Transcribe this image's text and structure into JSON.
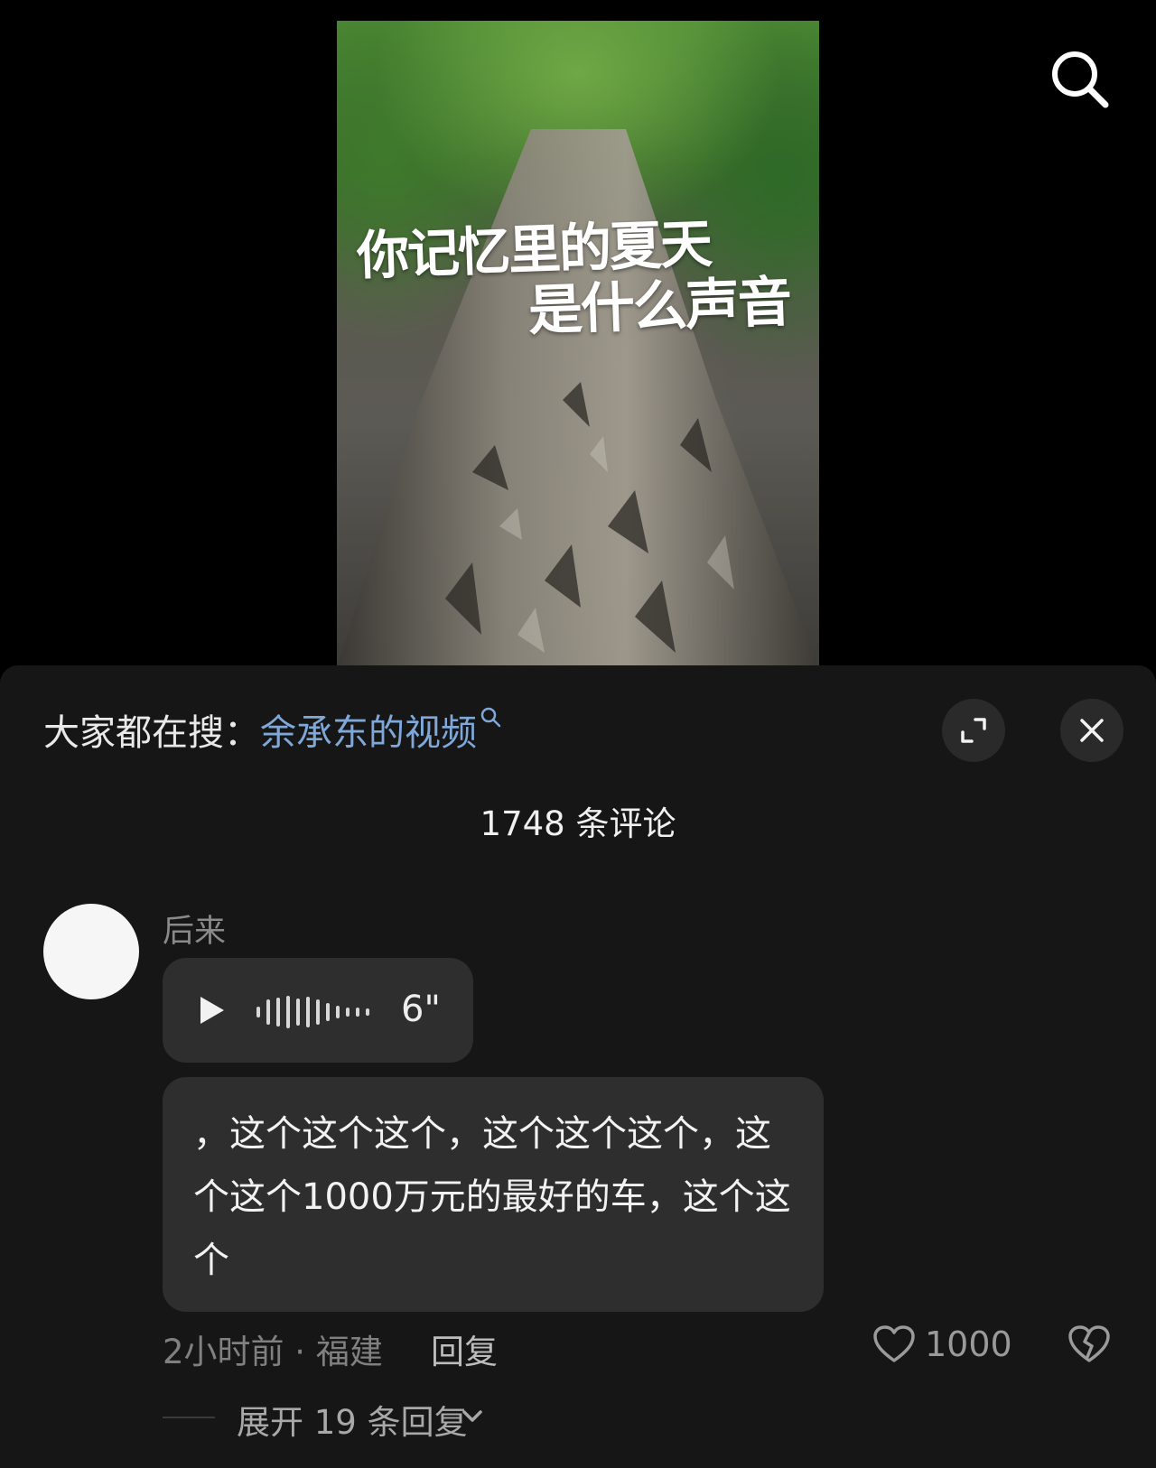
{
  "video": {
    "poster_title_line1": "你记忆里的夏天",
    "poster_title_line2": "是什么声音"
  },
  "top_bar": {
    "search_icon": "search-icon"
  },
  "sheet": {
    "trending_prefix": "大家都在搜：",
    "trending_query": "余承东的视频",
    "expand_icon": "expand-icon",
    "close_icon": "close-icon",
    "comment_count_label": "1748 条评论"
  },
  "comment": {
    "username": "后来",
    "voice_duration": "6\"",
    "transcript": "，这个这个这个，这个这个这个，这个这个1000万元的最好的车，这个这个",
    "time_location": "2小时前 · 福建",
    "reply_label": "回复",
    "like_count": "1000",
    "expand_replies_label": "展开 19 条回复"
  },
  "colors": {
    "sheet_background": "#161616",
    "bubble_background": "#2e2e2e",
    "link_blue": "#7fa8d9",
    "muted_text": "#808080"
  }
}
